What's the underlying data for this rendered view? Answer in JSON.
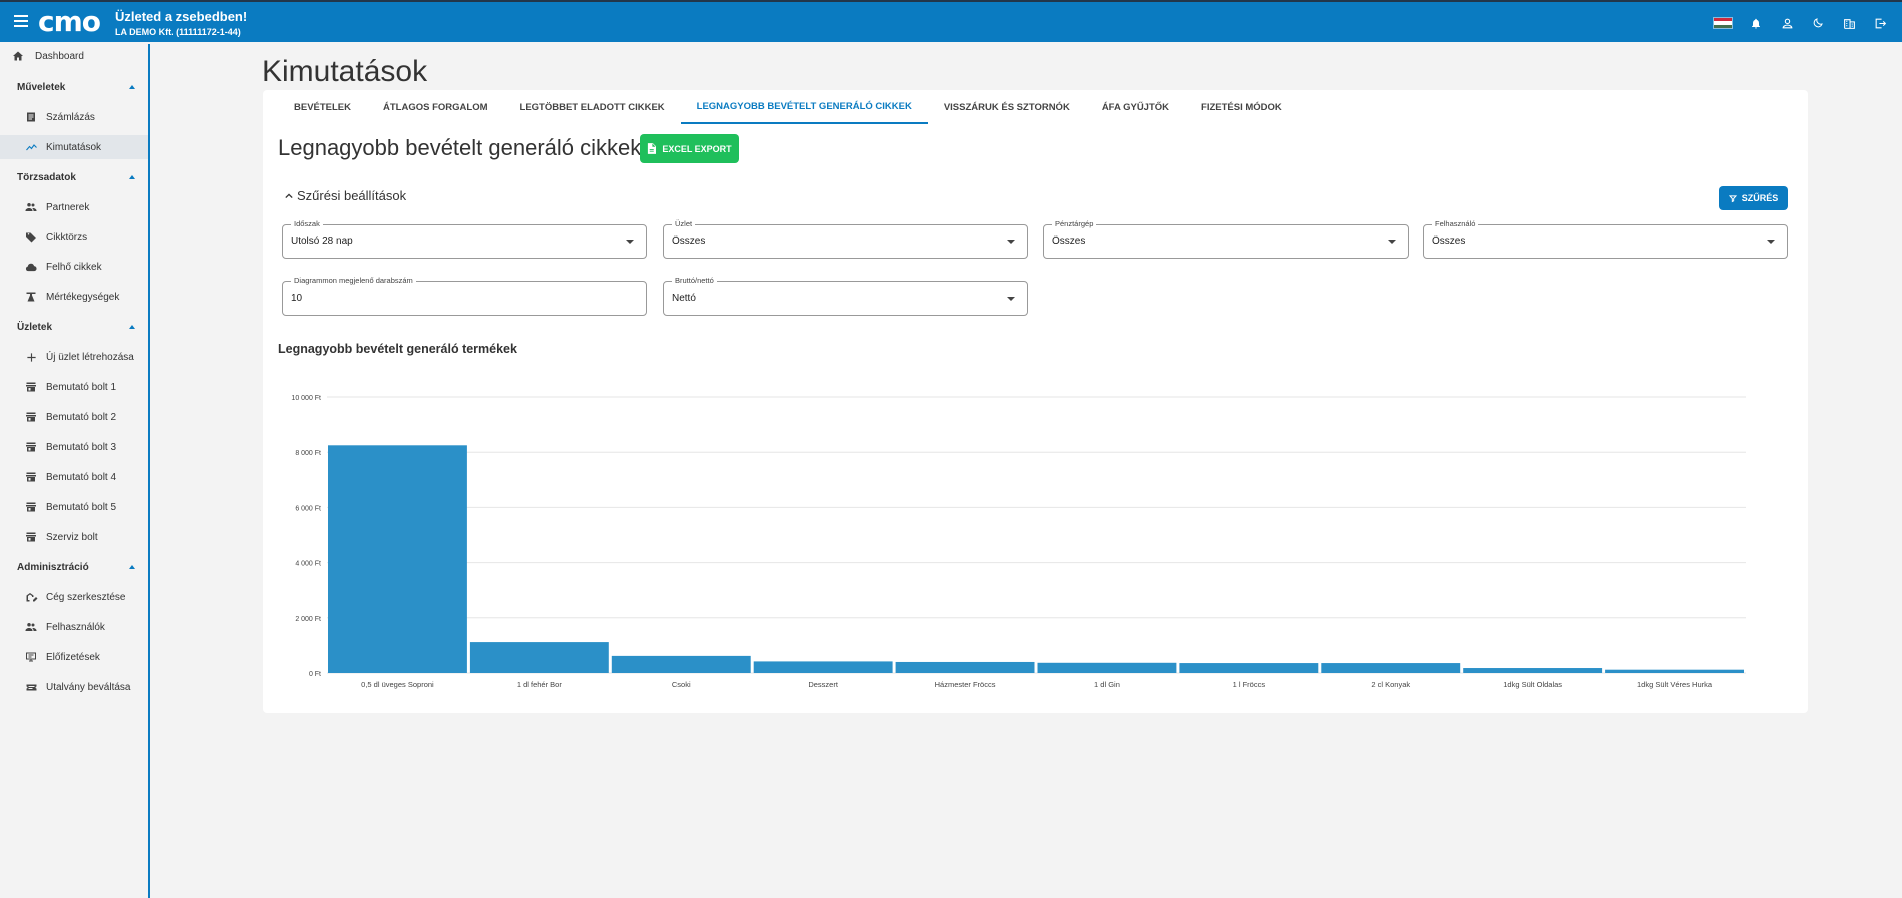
{
  "topbar": {
    "logo_text": "cmo",
    "title": "Üzleted a zsebedben!",
    "subtitle": "LA DEMO Kft. (11111172-1-44)",
    "icons": [
      "menu-icon",
      "hungarian-flag-icon",
      "bell-icon",
      "user-icon",
      "dark-mode-icon",
      "company-icon",
      "logout-icon"
    ]
  },
  "sidebar": {
    "dashboard": "Dashboard",
    "sections": [
      {
        "title": "Műveletek",
        "items": [
          "Számlázás",
          "Kimutatások"
        ]
      },
      {
        "title": "Törzsadatok",
        "items": [
          "Partnerek",
          "Cikktörzs",
          "Felhő cikkek",
          "Mértékegységek"
        ]
      },
      {
        "title": "Üzletek",
        "items": [
          "Új üzlet létrehozása",
          "Bemutató bolt 1",
          "Bemutató bolt 2",
          "Bemutató bolt 3",
          "Bemutató bolt 4",
          "Bemutató bolt 5",
          "Szerviz bolt"
        ]
      },
      {
        "title": "Adminisztráció",
        "items": [
          "Cég szerkesztése",
          "Felhasználók",
          "Előfizetések",
          "Utalvány beváltása"
        ]
      }
    ],
    "active_item": "Kimutatások"
  },
  "page": {
    "title": "Kimutatások",
    "tabs": [
      "Bevételek",
      "Átlagos forgalom",
      "Legtöbbet eladott cikkek",
      "Legnagyobb bevételt generáló cikkek",
      "Visszáruk és sztornók",
      "ÁFA gyűjtők",
      "Fizetési módok"
    ],
    "active_tab": 3,
    "section_title": "Legnagyobb bevételt generáló cikkek",
    "excel_button": "EXCEL EXPORT",
    "filter_toggle": "Szűrési beállítások",
    "filter_button": "SZŰRÉS",
    "fields": [
      {
        "label": "Időszak",
        "value": "Utolsó 28 nap"
      },
      {
        "label": "Üzlet",
        "value": "Összes"
      },
      {
        "label": "Pénztárgép",
        "value": "Összes"
      },
      {
        "label": "Felhasználó",
        "value": "Összes"
      },
      {
        "label": "Diagrammon megjelenő darabszám",
        "value": "10"
      },
      {
        "label": "Bruttó/nettó",
        "value": "Nettó"
      }
    ],
    "chart_title": "Legnagyobb bevételt generáló termékek"
  },
  "colors": {
    "primary": "#0a7bc1",
    "excel": "#1fbf5b",
    "bar": "#2b90c8"
  },
  "chart_data": {
    "type": "bar",
    "categories": [
      "0,5 dl üveges Soproni",
      "1 dl fehér Bor",
      "Csoki",
      "Desszert",
      "Házmester Fröccs",
      "1 dl Gin",
      "1 l Fröccs",
      "2 cl Konyak",
      "1dkg Sült Oldalas",
      "1dkg Sült Véres Hurka"
    ],
    "values": [
      8250,
      1120,
      620,
      420,
      400,
      370,
      360,
      360,
      180,
      120
    ],
    "yticks": [
      "0 Ft",
      "2 000 Ft",
      "4 000 Ft",
      "6 000 Ft",
      "8 000 Ft",
      "10 000 Ft"
    ],
    "ylim": [
      0,
      10000
    ],
    "grid": true
  }
}
